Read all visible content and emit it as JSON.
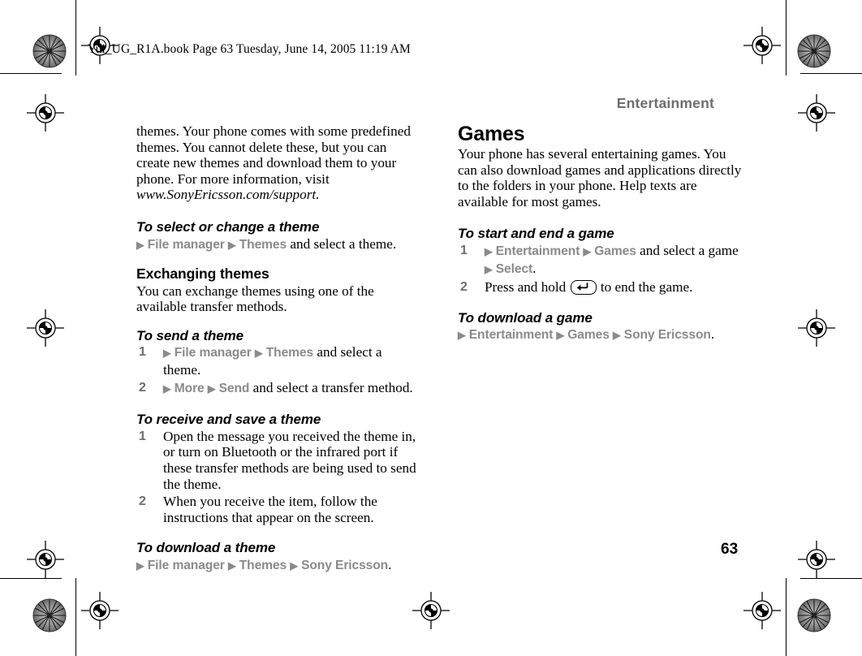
{
  "document": {
    "header_line": "Yui_UG_R1A.book  Page 63  Tuesday, June 14, 2005  11:19 AM",
    "running_head": "Entertainment",
    "page_number": "63"
  },
  "left_column": {
    "intro_paragraph": {
      "text_before": "themes. Your phone comes with some predefined themes. You cannot delete these, but you can create new themes and download them to your phone. For more information, visit ",
      "url": "www.SonyEricsson.com/support",
      "text_after": "."
    },
    "section_select_theme": {
      "heading": "To select or change a theme",
      "path": {
        "item1": "File manager",
        "item2": "Themes",
        "tail": " and select a theme."
      }
    },
    "section_exchanging": {
      "heading": "Exchanging themes",
      "paragraph": "You can exchange themes using one of the available transfer methods."
    },
    "section_send_theme": {
      "heading": "To send a theme",
      "steps": [
        {
          "num": "1",
          "path_item1": "File manager",
          "path_item2": "Themes",
          "tail": " and select a theme."
        },
        {
          "num": "2",
          "path_item1": "More",
          "path_item2": "Send",
          "tail": " and select a transfer method."
        }
      ]
    },
    "section_receive_theme": {
      "heading": "To receive and save a theme",
      "steps": [
        {
          "num": "1",
          "text": "Open the message you received the theme in, or turn on Bluetooth or the infrared port if these transfer methods are being used to send the theme."
        },
        {
          "num": "2",
          "text": "When you receive the item, follow the instructions that appear on the screen."
        }
      ]
    },
    "section_download_theme": {
      "heading": "To download a theme",
      "path": {
        "item1": "File manager",
        "item2": "Themes",
        "item3": "Sony Ericsson",
        "tail": "."
      }
    }
  },
  "right_column": {
    "section_games": {
      "heading": "Games",
      "paragraph": "Your phone has several entertaining games. You can also download games and applications directly to the folders in your phone. Help texts are available for most games."
    },
    "section_start_end_game": {
      "heading": "To start and end a game",
      "steps": [
        {
          "num": "1",
          "path_item1": "Entertainment",
          "path_item2": "Games",
          "mid": " and select a game ",
          "path_item3": "Select",
          "tail": "."
        },
        {
          "num": "2",
          "text_before": "Press and hold ",
          "key_icon": "back-key-icon",
          "text_after": " to end the game."
        }
      ]
    },
    "section_download_game": {
      "heading": "To download a game",
      "path": {
        "item1": "Entertainment",
        "item2": "Games",
        "item3": "Sony Ericsson",
        "tail": "."
      }
    }
  },
  "symbols": {
    "triangle": "▶"
  }
}
